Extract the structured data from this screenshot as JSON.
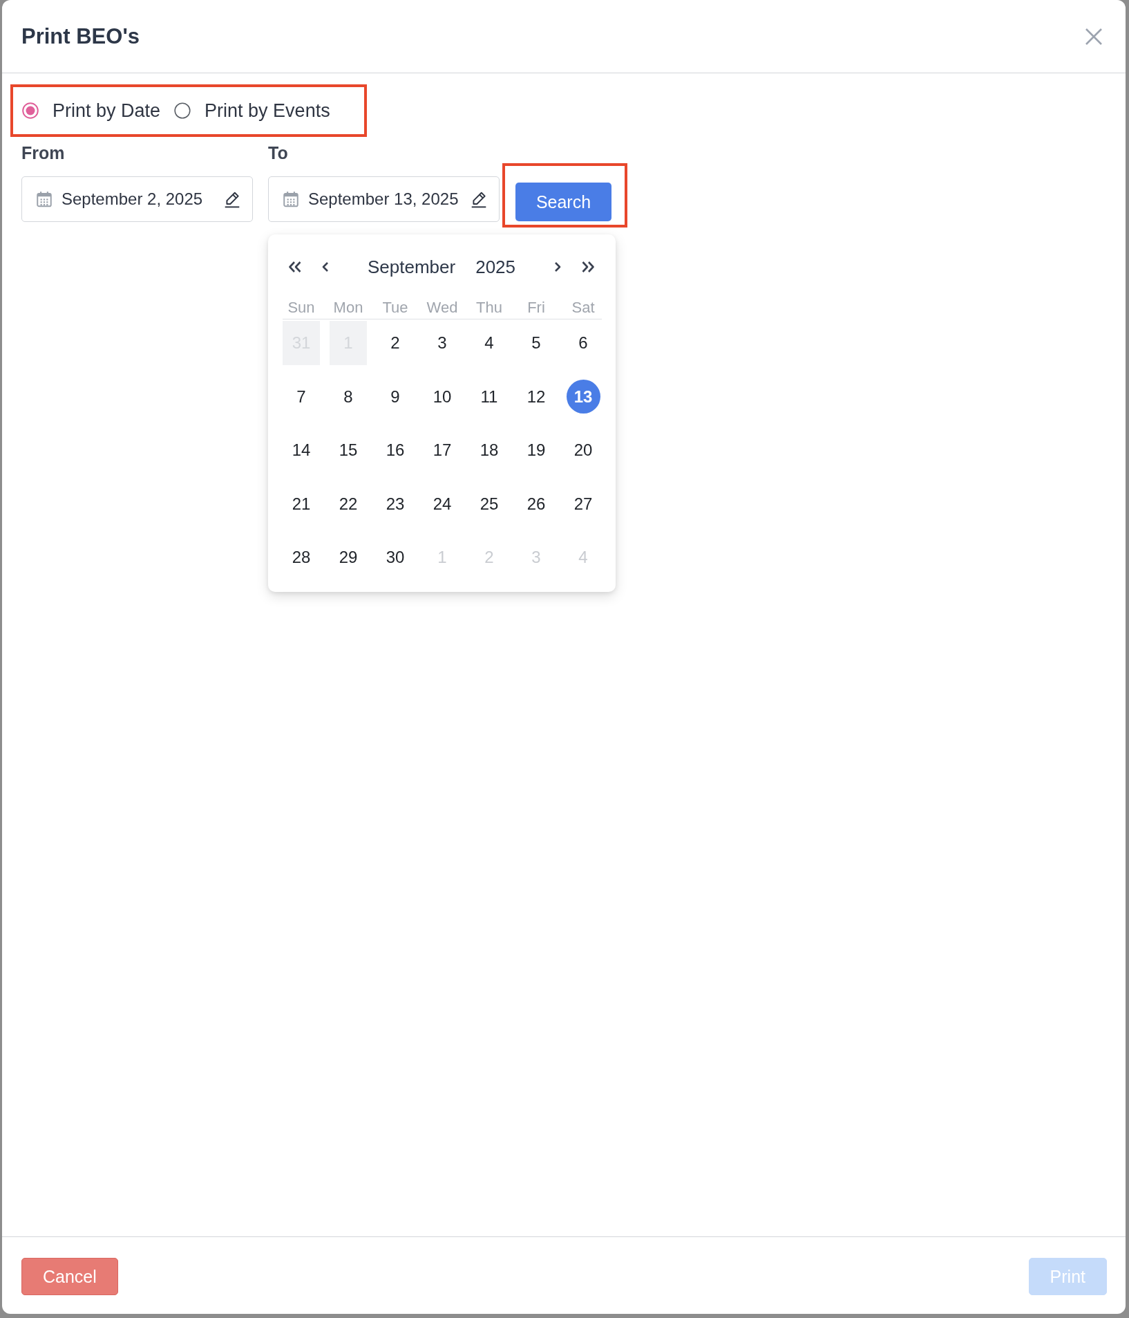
{
  "dialog": {
    "title": "Print BEO's"
  },
  "print_mode": {
    "highlighted": true,
    "options": [
      {
        "label": "Print by Date",
        "selected": true
      },
      {
        "label": "Print by Events",
        "selected": false
      }
    ]
  },
  "date_range": {
    "fields": [
      {
        "label": "From",
        "value": "September 2, 2025"
      },
      {
        "label": "To",
        "value": "September 13, 2025",
        "calendar": {
          "month": "September",
          "year": "2025",
          "weekdays": [
            "Sun",
            "Mon",
            "Tue",
            "Wed",
            "Thu",
            "Fri",
            "Sat"
          ],
          "days": [
            {
              "day": "31",
              "outside_month": true,
              "disabled": true,
              "selected": false
            },
            {
              "day": "1",
              "outside_month": false,
              "disabled": true,
              "selected": false
            },
            {
              "day": "2",
              "outside_month": false,
              "disabled": false,
              "selected": false
            },
            {
              "day": "3",
              "outside_month": false,
              "disabled": false,
              "selected": false
            },
            {
              "day": "4",
              "outside_month": false,
              "disabled": false,
              "selected": false
            },
            {
              "day": "5",
              "outside_month": false,
              "disabled": false,
              "selected": false
            },
            {
              "day": "6",
              "outside_month": false,
              "disabled": false,
              "selected": false
            },
            {
              "day": "7",
              "outside_month": false,
              "disabled": false,
              "selected": false
            },
            {
              "day": "8",
              "outside_month": false,
              "disabled": false,
              "selected": false
            },
            {
              "day": "9",
              "outside_month": false,
              "disabled": false,
              "selected": false
            },
            {
              "day": "10",
              "outside_month": false,
              "disabled": false,
              "selected": false
            },
            {
              "day": "11",
              "outside_month": false,
              "disabled": false,
              "selected": false
            },
            {
              "day": "12",
              "outside_month": false,
              "disabled": false,
              "selected": false
            },
            {
              "day": "13",
              "outside_month": false,
              "disabled": false,
              "selected": true
            },
            {
              "day": "14",
              "outside_month": false,
              "disabled": false,
              "selected": false
            },
            {
              "day": "15",
              "outside_month": false,
              "disabled": false,
              "selected": false
            },
            {
              "day": "16",
              "outside_month": false,
              "disabled": false,
              "selected": false
            },
            {
              "day": "17",
              "outside_month": false,
              "disabled": false,
              "selected": false
            },
            {
              "day": "18",
              "outside_month": false,
              "disabled": false,
              "selected": false
            },
            {
              "day": "19",
              "outside_month": false,
              "disabled": false,
              "selected": false
            },
            {
              "day": "20",
              "outside_month": false,
              "disabled": false,
              "selected": false
            },
            {
              "day": "21",
              "outside_month": false,
              "disabled": false,
              "selected": false
            },
            {
              "day": "22",
              "outside_month": false,
              "disabled": false,
              "selected": false
            },
            {
              "day": "23",
              "outside_month": false,
              "disabled": false,
              "selected": false
            },
            {
              "day": "24",
              "outside_month": false,
              "disabled": false,
              "selected": false
            },
            {
              "day": "25",
              "outside_month": false,
              "disabled": false,
              "selected": false
            },
            {
              "day": "26",
              "outside_month": false,
              "disabled": false,
              "selected": false
            },
            {
              "day": "27",
              "outside_month": false,
              "disabled": false,
              "selected": false
            },
            {
              "day": "28",
              "outside_month": false,
              "disabled": false,
              "selected": false
            },
            {
              "day": "29",
              "outside_month": false,
              "disabled": false,
              "selected": false
            },
            {
              "day": "30",
              "outside_month": false,
              "disabled": false,
              "selected": false
            },
            {
              "day": "1",
              "outside_month": true,
              "disabled": false,
              "selected": false
            },
            {
              "day": "2",
              "outside_month": true,
              "disabled": false,
              "selected": false
            },
            {
              "day": "3",
              "outside_month": true,
              "disabled": false,
              "selected": false
            },
            {
              "day": "4",
              "outside_month": true,
              "disabled": false,
              "selected": false
            }
          ]
        }
      }
    ],
    "search_button": {
      "label": "Search",
      "highlighted": true
    }
  },
  "footer": {
    "buttons": [
      {
        "label": "Cancel",
        "kind": "danger",
        "disabled": false
      },
      {
        "label": "Print",
        "kind": "primary",
        "disabled": true
      }
    ]
  }
}
